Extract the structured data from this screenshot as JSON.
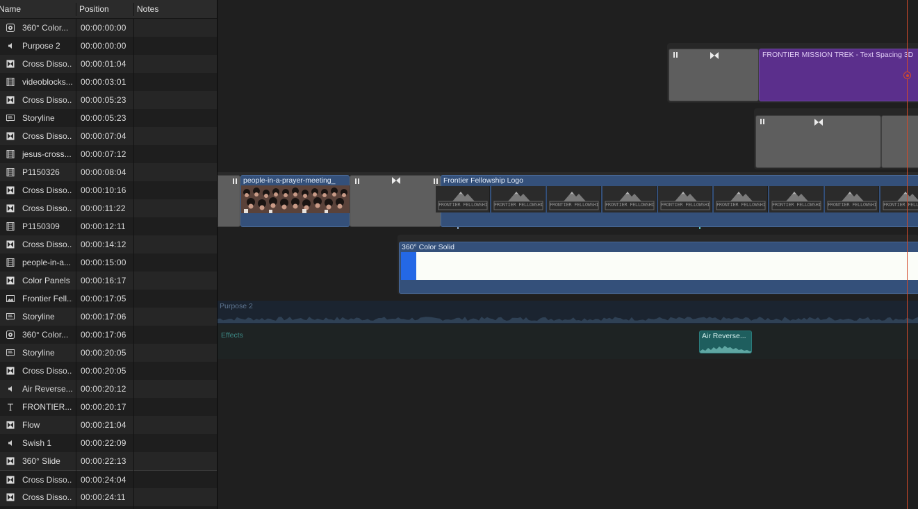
{
  "index": {
    "headers": {
      "name": "Name",
      "position": "Position",
      "notes": "Notes"
    },
    "rows": [
      {
        "icon": "color-solid-icon",
        "name": "360° Color...",
        "position": "00:00:00:00"
      },
      {
        "icon": "audio-speaker-icon",
        "name": "Purpose 2",
        "position": "00:00:00:00"
      },
      {
        "icon": "transition-icon",
        "name": "Cross Disso...",
        "position": "00:00:01:04"
      },
      {
        "icon": "video-clip-icon",
        "name": "videoblocks...",
        "position": "00:00:03:01"
      },
      {
        "icon": "transition-icon",
        "name": "Cross Disso...",
        "position": "00:00:05:23"
      },
      {
        "icon": "storyline-icon",
        "name": "Storyline",
        "position": "00:00:05:23"
      },
      {
        "icon": "transition-icon",
        "name": "Cross Disso...",
        "position": "00:00:07:04"
      },
      {
        "icon": "video-clip-icon",
        "name": "jesus-cross...",
        "position": "00:00:07:12"
      },
      {
        "icon": "video-clip-icon",
        "name": "P1150326",
        "position": "00:00:08:04"
      },
      {
        "icon": "transition-icon",
        "name": "Cross Disso...",
        "position": "00:00:10:16"
      },
      {
        "icon": "transition-icon",
        "name": "Cross Disso...",
        "position": "00:00:11:22"
      },
      {
        "icon": "video-clip-icon",
        "name": "P1150309",
        "position": "00:00:12:11"
      },
      {
        "icon": "transition-icon",
        "name": "Cross Disso...",
        "position": "00:00:14:12"
      },
      {
        "icon": "video-clip-icon",
        "name": "people-in-a...",
        "position": "00:00:15:00"
      },
      {
        "icon": "transition-icon",
        "name": "Color Panels",
        "position": "00:00:16:17"
      },
      {
        "icon": "image-icon",
        "name": "Frontier Fell...",
        "position": "00:00:17:05"
      },
      {
        "icon": "storyline-icon",
        "name": "Storyline",
        "position": "00:00:17:06"
      },
      {
        "icon": "color-solid-icon",
        "name": "360° Color...",
        "position": "00:00:17:06"
      },
      {
        "icon": "storyline-icon",
        "name": "Storyline",
        "position": "00:00:20:05"
      },
      {
        "icon": "transition-icon",
        "name": "Cross Disso...",
        "position": "00:00:20:05"
      },
      {
        "icon": "audio-speaker-icon",
        "name": "Air Reverse...",
        "position": "00:00:20:12"
      },
      {
        "icon": "title-text-icon",
        "name": "FRONTIER...",
        "position": "00:00:20:17"
      },
      {
        "icon": "transition-icon",
        "name": "Flow",
        "position": "00:00:21:04"
      },
      {
        "icon": "audio-speaker-icon",
        "name": "Swish 1",
        "position": "00:00:22:09"
      },
      {
        "icon": "transition-icon",
        "name": "360° Slide",
        "position": "00:00:22:13"
      },
      {
        "icon": "transition-icon",
        "name": "Cross Disso...",
        "position": "00:00:24:04"
      },
      {
        "icon": "transition-icon",
        "name": "Cross Disso...",
        "position": "00:00:24:11"
      }
    ]
  },
  "timeline": {
    "title_clip": "FRONTIER MISSION TREK - Text Spacing 3D",
    "video_clip": "people-in-a-prayer-meeting_",
    "logo_clip": "Frontier Fellowship Logo",
    "logo_text": "FRONTIER FELLOWSHIP",
    "color_clip": "360° Color Solid",
    "audio_lane": "Purpose 2",
    "effects_lane": "Effects",
    "effects_clip": "Air Reverse..."
  },
  "colors": {
    "title_clip": "#5b2f8c",
    "primary_clip": "#34507a",
    "transition": "#5e5e5e",
    "audio_teal": "#1e5e5e",
    "playhead": "#d24a2b",
    "selection_blue": "#2468e6"
  }
}
